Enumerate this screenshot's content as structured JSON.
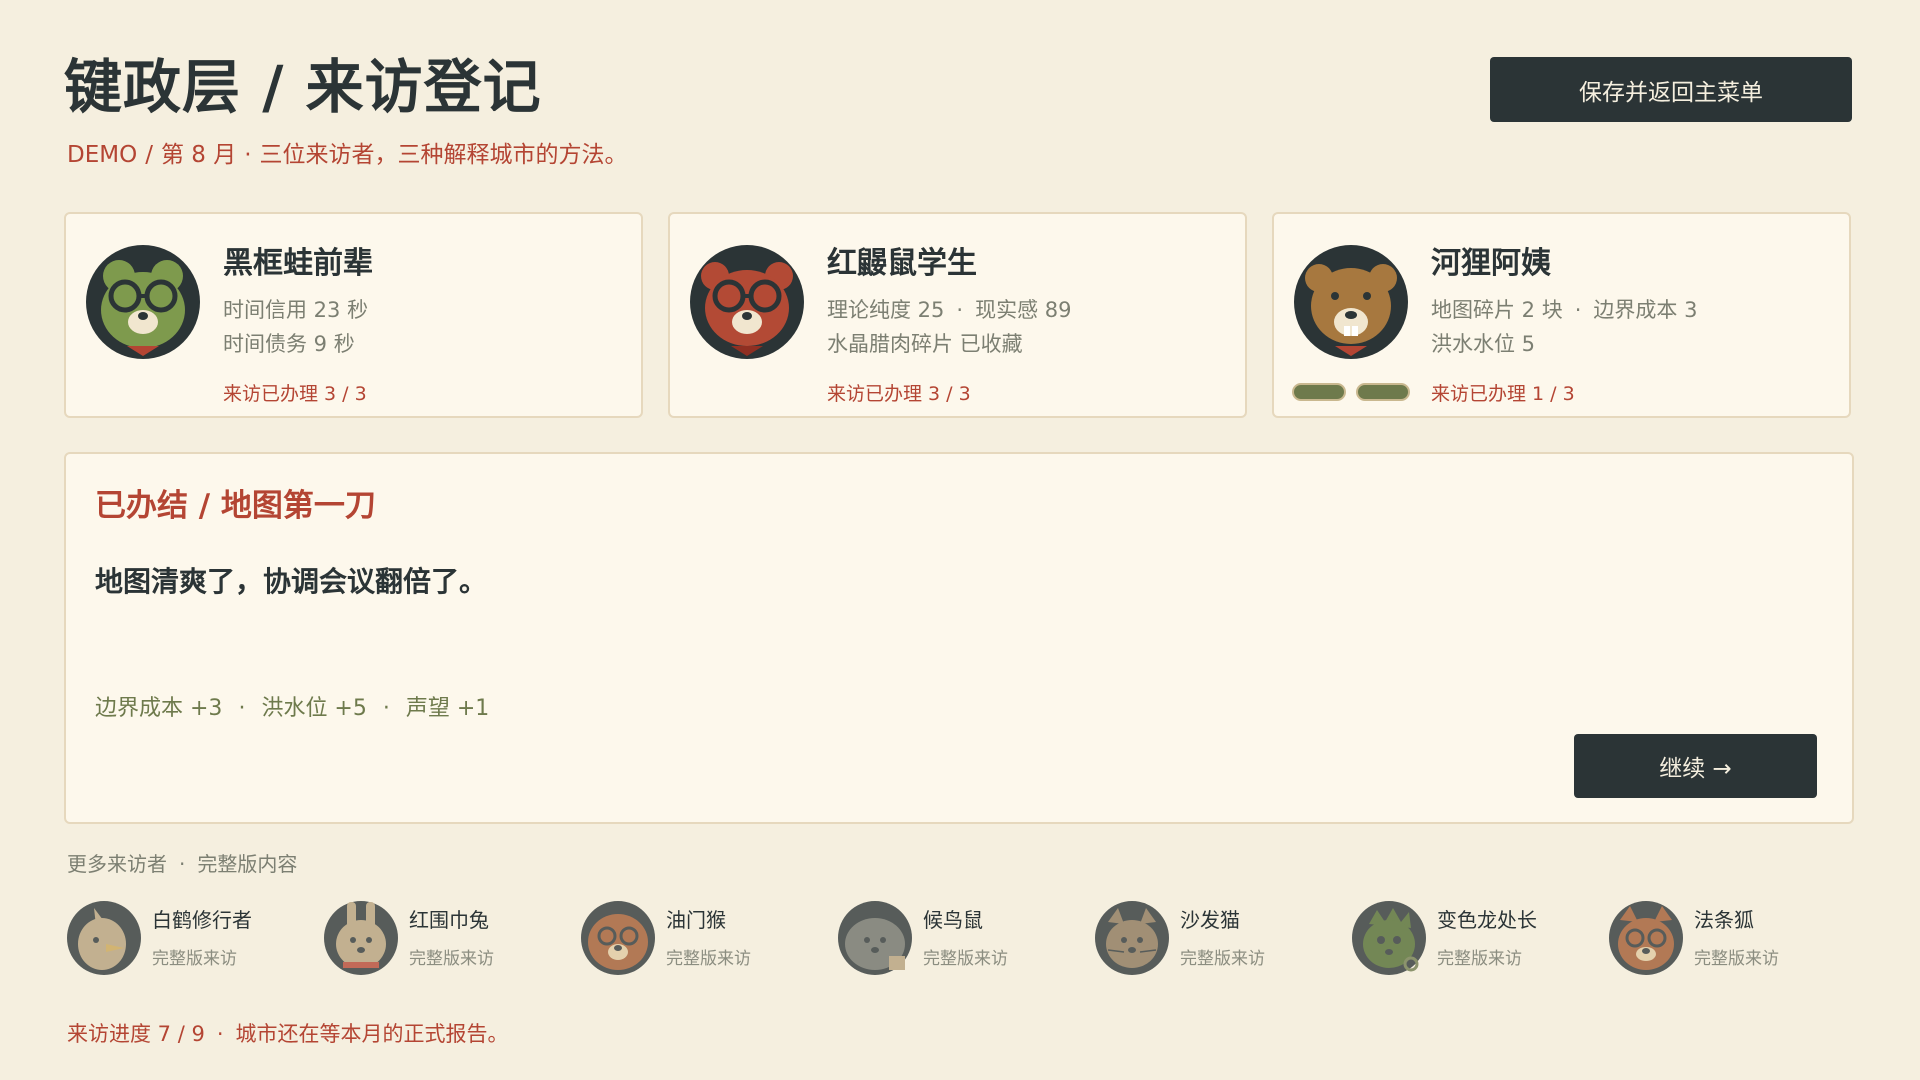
{
  "header": {
    "title": "键政层 / 来访登记",
    "subtitle_demo": "DEMO",
    "subtitle_sep": "/",
    "subtitle_month": "第 8 月",
    "subtitle_dot": "·",
    "subtitle_text": "三位来访者，三种解释城市的方法。",
    "save_button": "保存并返回主菜单"
  },
  "cards": [
    {
      "name": "黑框蛙前辈",
      "line1": "时间信用  23 秒",
      "line2": "时间债务  9 秒",
      "visit": "来访已办理 3 / 3",
      "avatar_color": "#7e9a4d"
    },
    {
      "name": "红鼹鼠学生",
      "line1a": "理论纯度  25",
      "line1b": "现实感  89",
      "line2": "水晶腊肉碎片  已收藏",
      "visit": "来访已办理 3 / 3",
      "avatar_color": "#b34a35"
    },
    {
      "name": "河狸阿姨",
      "line1a": "地图碎片  2 块",
      "line1b": "边界成本  3",
      "line2": "洪水水位  5",
      "visit": "来访已办理 1 / 3",
      "avatar_color": "#a7783f"
    }
  ],
  "result": {
    "title": "已办结 / 地图第一刀",
    "description": "地图清爽了，协调会议翻倍了。",
    "effects": [
      "边界成本 +3",
      "洪水位 +5",
      "声望 +1"
    ],
    "continue_button": "继续 →"
  },
  "more": {
    "label_a": "更多来访者",
    "label_b": "完整版内容",
    "visitors": [
      {
        "name": "白鹤修行者",
        "sub": "完整版来访"
      },
      {
        "name": "红围巾兔",
        "sub": "完整版来访"
      },
      {
        "name": "油门猴",
        "sub": "完整版来访"
      },
      {
        "name": "候鸟鼠",
        "sub": "完整版来访"
      },
      {
        "name": "沙发猫",
        "sub": "完整版来访"
      },
      {
        "name": "变色龙处长",
        "sub": "完整版来访"
      },
      {
        "name": "法条狐",
        "sub": "完整版来访"
      }
    ]
  },
  "footer": {
    "progress": "来访进度 7 / 9",
    "message": "城市还在等本月的正式报告。"
  },
  "colors": {
    "background": "#f5efdf",
    "accent_red": "#b44533",
    "dark": "#2b3436",
    "olive": "#6e7a4c"
  }
}
